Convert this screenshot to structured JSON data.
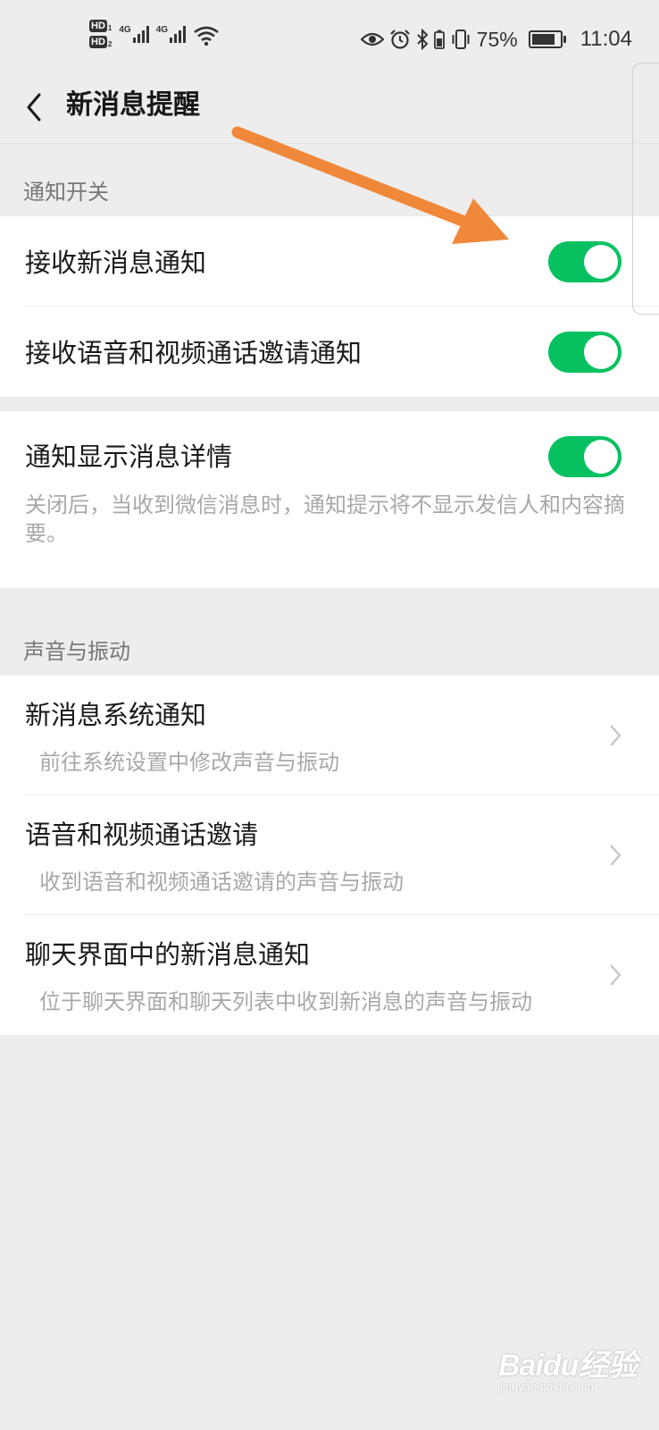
{
  "status_bar": {
    "hd1": "HD",
    "hd1_sub": "1",
    "hd2": "HD",
    "hd2_sub": "2",
    "network1": "4G",
    "network2": "4G",
    "battery_percent": "75%",
    "battery_level": 0.75,
    "time": "11:04",
    "icons": [
      "eye-icon",
      "alarm-icon",
      "bluetooth-icon",
      "vibrate-icon",
      "battery-icon"
    ]
  },
  "header": {
    "title": "新消息提醒"
  },
  "sections": {
    "notification_switch": {
      "title": "通知开关",
      "items": [
        {
          "label": "接收新消息通知",
          "enabled": true
        },
        {
          "label": "接收语音和视频通话邀请通知",
          "enabled": true
        }
      ]
    },
    "detail": {
      "label": "通知显示消息详情",
      "enabled": true,
      "description": "关闭后，当收到微信消息时，通知提示将不显示发信人和内容摘要。"
    },
    "sound": {
      "title": "声音与振动",
      "items": [
        {
          "label": "新消息系统通知",
          "sub": "前往系统设置中修改声音与振动"
        },
        {
          "label": "语音和视频通话邀请",
          "sub": "收到语音和视频通话邀请的声音与振动"
        },
        {
          "label": "聊天界面中的新消息通知",
          "sub": "位于聊天界面和聊天列表中收到新消息的声音与振动"
        }
      ]
    }
  },
  "colors": {
    "toggle_on": "#07c160",
    "background": "#ededed",
    "arrow": "#f0883a"
  },
  "watermark": {
    "logo": "Baidu经验",
    "url": "jingyan.baidu.com"
  }
}
